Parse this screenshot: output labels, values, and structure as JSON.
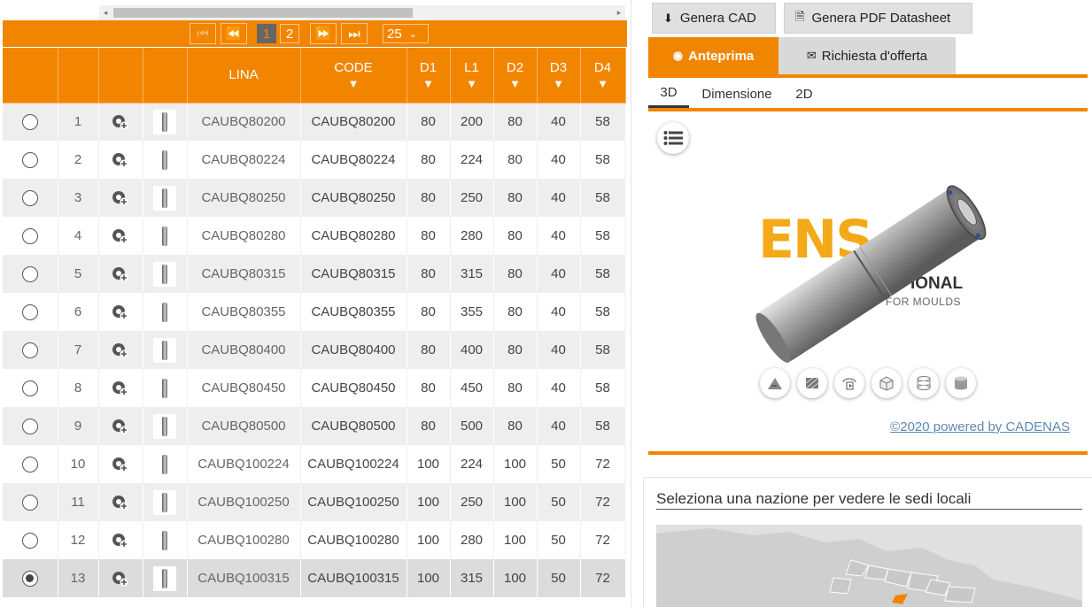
{
  "pager": {
    "first": "⏮",
    "prev": "⏪",
    "pages": [
      "1",
      "2"
    ],
    "active_page": "1",
    "next": "⏩",
    "last": "⏭",
    "page_size": "25"
  },
  "grid": {
    "columns": [
      "",
      "",
      "",
      "",
      "LINA",
      "CODE",
      "D1",
      "L1",
      "D2",
      "D3",
      "D4"
    ],
    "rows": [
      {
        "n": "1",
        "lina": "CAUBQ80200",
        "code": "CAUBQ80200",
        "d1": "80",
        "l1": "200",
        "d2": "80",
        "d3": "40",
        "d4": "58"
      },
      {
        "n": "2",
        "lina": "CAUBQ80224",
        "code": "CAUBQ80224",
        "d1": "80",
        "l1": "224",
        "d2": "80",
        "d3": "40",
        "d4": "58"
      },
      {
        "n": "3",
        "lina": "CAUBQ80250",
        "code": "CAUBQ80250",
        "d1": "80",
        "l1": "250",
        "d2": "80",
        "d3": "40",
        "d4": "58"
      },
      {
        "n": "4",
        "lina": "CAUBQ80280",
        "code": "CAUBQ80280",
        "d1": "80",
        "l1": "280",
        "d2": "80",
        "d3": "40",
        "d4": "58"
      },
      {
        "n": "5",
        "lina": "CAUBQ80315",
        "code": "CAUBQ80315",
        "d1": "80",
        "l1": "315",
        "d2": "80",
        "d3": "40",
        "d4": "58"
      },
      {
        "n": "6",
        "lina": "CAUBQ80355",
        "code": "CAUBQ80355",
        "d1": "80",
        "l1": "355",
        "d2": "80",
        "d3": "40",
        "d4": "58"
      },
      {
        "n": "7",
        "lina": "CAUBQ80400",
        "code": "CAUBQ80400",
        "d1": "80",
        "l1": "400",
        "d2": "80",
        "d3": "40",
        "d4": "58"
      },
      {
        "n": "8",
        "lina": "CAUBQ80450",
        "code": "CAUBQ80450",
        "d1": "80",
        "l1": "450",
        "d2": "80",
        "d3": "40",
        "d4": "58"
      },
      {
        "n": "9",
        "lina": "CAUBQ80500",
        "code": "CAUBQ80500",
        "d1": "80",
        "l1": "500",
        "d2": "80",
        "d3": "40",
        "d4": "58"
      },
      {
        "n": "10",
        "lina": "CAUBQ100224",
        "code": "CAUBQ100224",
        "d1": "100",
        "l1": "224",
        "d2": "100",
        "d3": "50",
        "d4": "72"
      },
      {
        "n": "11",
        "lina": "CAUBQ100250",
        "code": "CAUBQ100250",
        "d1": "100",
        "l1": "250",
        "d2": "100",
        "d3": "50",
        "d4": "72"
      },
      {
        "n": "12",
        "lina": "CAUBQ100280",
        "code": "CAUBQ100280",
        "d1": "100",
        "l1": "280",
        "d2": "100",
        "d3": "50",
        "d4": "72"
      },
      {
        "n": "13",
        "lina": "CAUBQ100315",
        "code": "CAUBQ100315",
        "d1": "100",
        "l1": "315",
        "d2": "100",
        "d3": "50",
        "d4": "72"
      }
    ],
    "selected_row": "13"
  },
  "toolbar": {
    "genera_cad": "Genera CAD",
    "genera_pdf": "Genera PDF Datasheet"
  },
  "tabs": {
    "anteprima": "Anteprima",
    "richiesta": "Richiesta d'offerta"
  },
  "subtabs": [
    "3D",
    "Dimensione",
    "2D"
  ],
  "viewer": {
    "logo_main": "ENS",
    "logo_tail": "IONAL",
    "logo_sub": "FOR MOULDS",
    "credit": "©2020 powered by CADENAS"
  },
  "map": {
    "title": "Seleziona una nazione per vedere le sedi locali"
  },
  "colors": {
    "accent": "#f28500",
    "link": "#5b8ab3"
  }
}
